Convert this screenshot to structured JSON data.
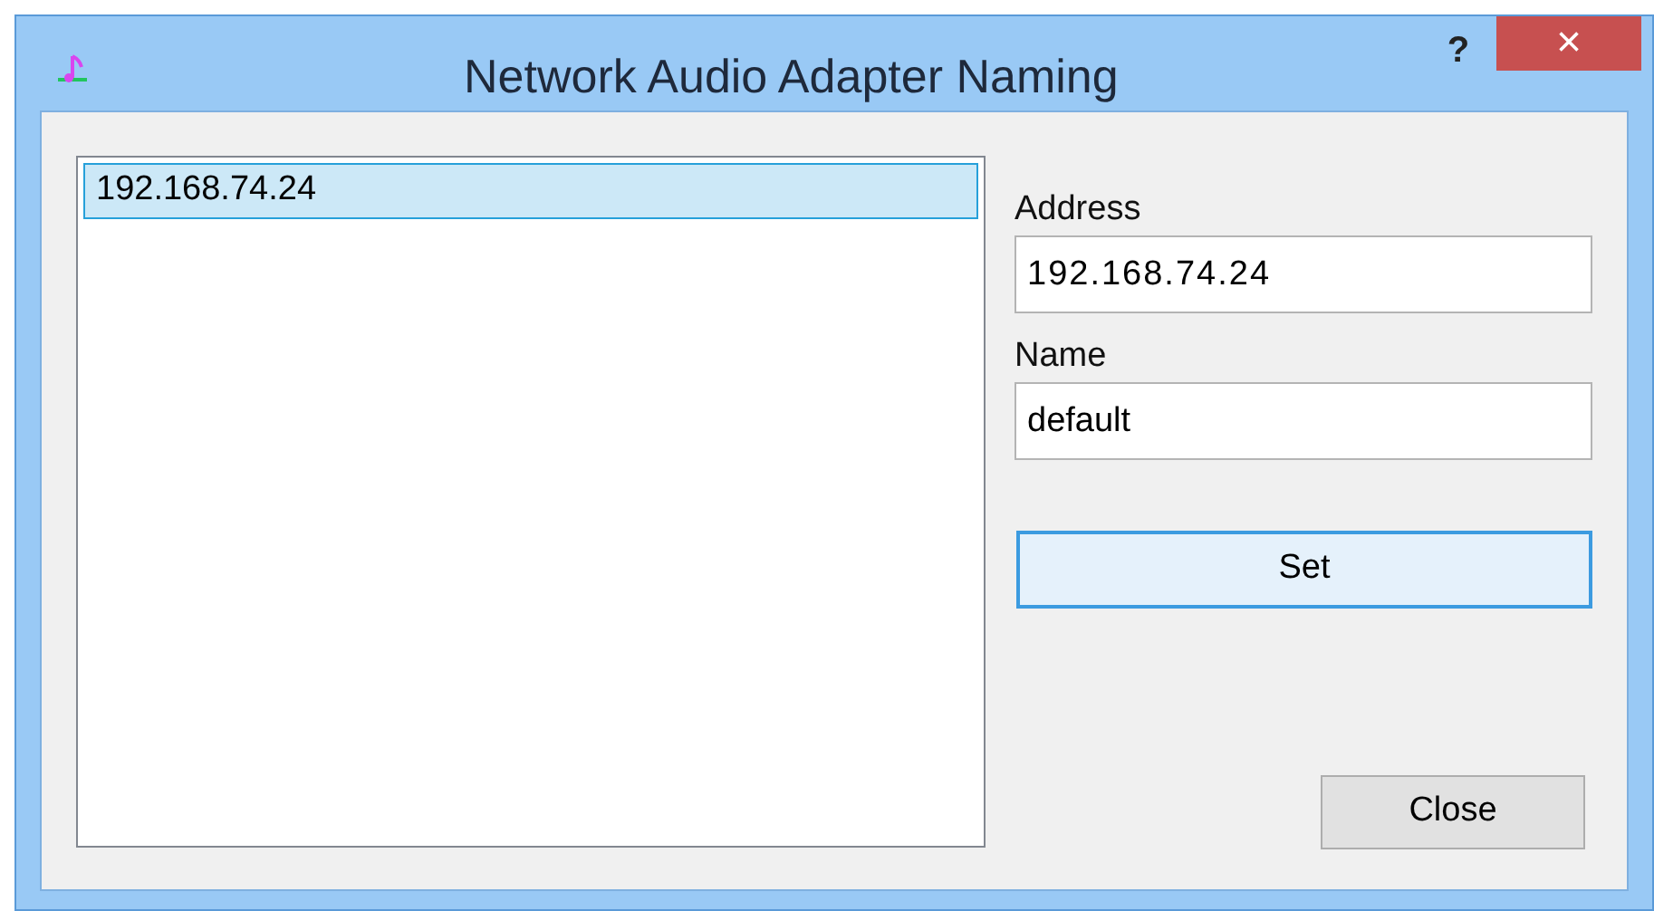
{
  "window": {
    "title": "Network Audio Adapter Naming",
    "help": "?",
    "close": "×"
  },
  "list": {
    "items": [
      {
        "label": "192.168.74.24",
        "selected": true
      }
    ]
  },
  "address": {
    "label": "Address",
    "value": "192.168.74.24"
  },
  "name": {
    "label": "Name",
    "value": "default"
  },
  "buttons": [
    {
      "label": "Set",
      "kind": "default"
    },
    {
      "label": "Close",
      "kind": "normal"
    }
  ]
}
